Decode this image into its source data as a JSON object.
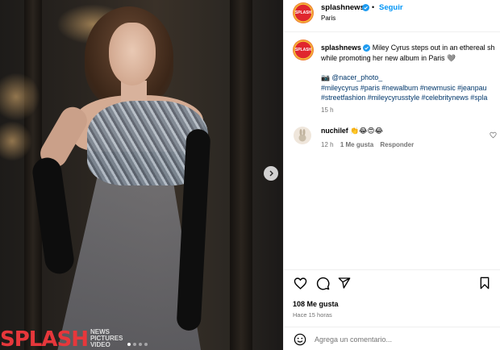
{
  "post": {
    "username": "splashnews",
    "location": "Paris",
    "follow_label": "Seguir",
    "avatar_text": "SPLASH",
    "caption_text": "Miley Cyrus steps out in an ethereal sh",
    "caption_line2": "while promoting her new album in Paris 🩶",
    "credit": "📷 @nacer_photo_",
    "hashtags_line1": "#mileycyrus #paris #newalbum #newmusic #jeanpau",
    "hashtags_line2": "#streetfashion #mileycyrusstyle #celebritynews #spla",
    "caption_time": "15 h"
  },
  "comment": {
    "username": "nuchilef",
    "text": "👏😂😍😂",
    "time": "12 h",
    "likes": "1 Me gusta",
    "reply_label": "Responder"
  },
  "engagement": {
    "likes": "108 Me gusta",
    "time": "Hace 15 horas"
  },
  "composer": {
    "placeholder": "Agrega un comentario..."
  },
  "media": {
    "watermark_brand": "SPLASH",
    "watermark_sub1": "NEWS",
    "watermark_sub2": "PICTURES",
    "watermark_sub3": "VIDEO",
    "carousel_count": 4,
    "carousel_active": 1
  },
  "colors": {
    "link": "#00376b",
    "verified": "#1d9bf0",
    "muted": "#737373",
    "brand": "#e7373b"
  }
}
